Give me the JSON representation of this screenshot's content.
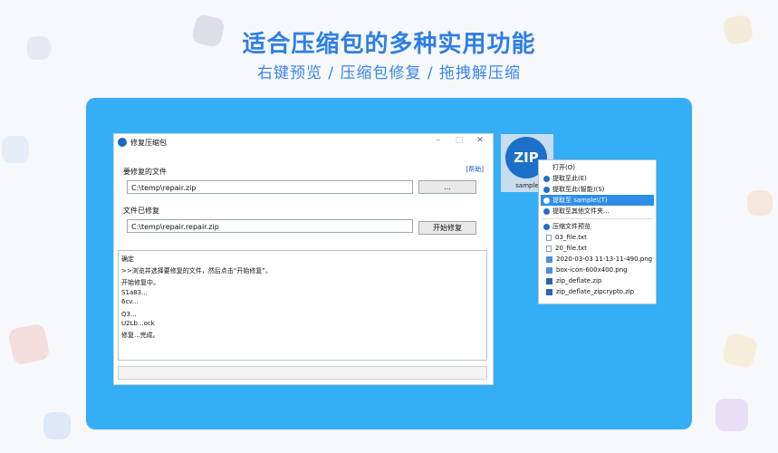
{
  "headline": "适合压缩包的多种实用功能",
  "subline": "右键预览 / 压缩包修复 / 拖拽解压缩",
  "dialog": {
    "title": "修复压缩包",
    "help_link": "[帮助]",
    "source_label": "要修复的文件",
    "source_value": "C:\\temp\\repair.zip",
    "browse_label": "...",
    "output_label": "文件已修复",
    "output_value": "C:\\temp\\repair.repair.zip",
    "start_label": "开始修复",
    "log_lines": [
      "确定",
      ">>浏览并选择要修复的文件，然后点击“开始修复”。",
      "开始修复中。",
      "S1a83...",
      "6cv...",
      "Q3...",
      "U2Lb...ock",
      "修复...完成。"
    ]
  },
  "tile": {
    "icon_text": "ZIP",
    "label": "sample"
  },
  "context_menu": {
    "items": [
      "打开(O)",
      "提取至此(E)",
      "提取至此(智能)(S)",
      "提取至 sample\\(T)",
      "提取至其他文件夹..."
    ],
    "preview_header": "压缩文件预览",
    "files": [
      "03_file.txt",
      "20_file.txt",
      "2020-03-03 11-13-11-490.png",
      "box-icon-600x400.png",
      "zip_deflate.zip",
      "zip_deflate_zipcrypto.zip"
    ]
  },
  "colors": {
    "panel": "#34aef5",
    "headline": "#2f7ee6",
    "selected_item": "#2c8ee6",
    "icon_blue": "#1b70c9"
  }
}
